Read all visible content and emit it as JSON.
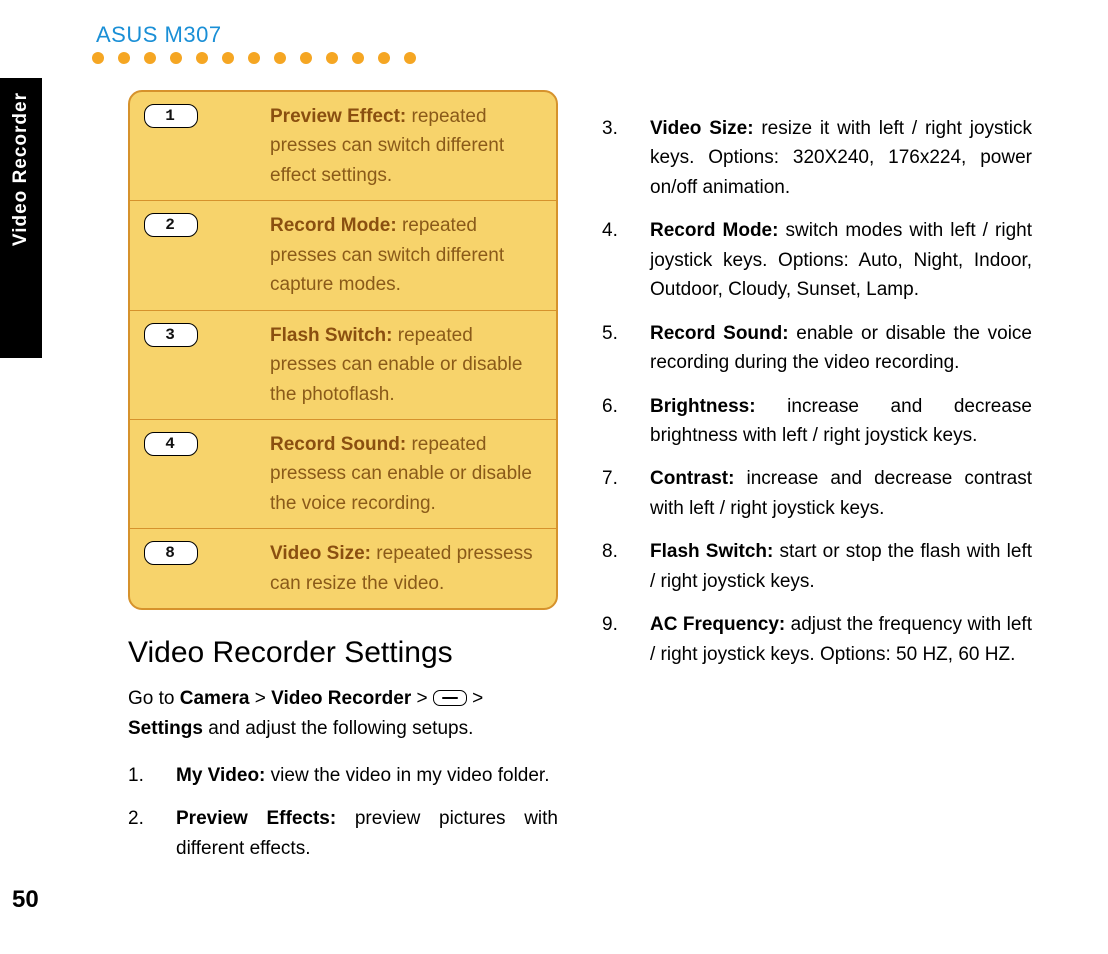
{
  "doc_title": "ASUS M307",
  "side_tab": "Video Recorder",
  "page_number": "50",
  "key_table": [
    {
      "key": "1",
      "lead": "Preview Effect:",
      "desc": " repeated presses can switch different effect settings."
    },
    {
      "key": "2",
      "lead": "Record Mode:",
      "desc": " repeated presses can switch different capture modes."
    },
    {
      "key": "3",
      "lead": "Flash Switch:",
      "desc": " repeated presses can enable or disable the photoflash."
    },
    {
      "key": "4",
      "lead": "Record Sound:",
      "desc": " repeated pressess can enable or disable the voice recording."
    },
    {
      "key": "8",
      "lead": "Video Size:",
      "desc": " repeated pressess can resize the video."
    }
  ],
  "section_heading": "Video Recorder Settings",
  "intro": {
    "pre": "Go to ",
    "b1": "Camera",
    "sep1": " > ",
    "b2": "Video Recorder",
    "sep2": " > ",
    "sep3": " > ",
    "b3": "Settings",
    "post": " and adjust the following setups."
  },
  "settings_left": [
    {
      "lead": "My Video:",
      "desc": " view the video in my video folder."
    },
    {
      "lead": "Preview Effects:",
      "desc": " preview pictures with different effects."
    }
  ],
  "settings_right": [
    {
      "lead": "Video Size:",
      "desc": " resize it with left / right joystick keys. Options: 320X240, 176x224, power on/off animation."
    },
    {
      "lead": "Record Mode:",
      "desc": " switch modes with left / right joystick keys. Options: Auto, Night, Indoor, Outdoor, Cloudy, Sunset, Lamp."
    },
    {
      "lead": "Record Sound:",
      "desc": "  enable or disable the voice recording during the video recording."
    },
    {
      "lead": "Brightness:",
      "desc": " increase and decrease brightness with left / right joystick keys."
    },
    {
      "lead": "Contrast:",
      "desc": " increase and decrease contrast with left / right joystick keys."
    },
    {
      "lead": "Flash Switch:",
      "desc": " start or stop the flash with left / right joystick keys."
    },
    {
      "lead": "AC Frequency:",
      "desc": " adjust the frequency with left / right joystick keys. Options: 50 HZ, 60 HZ."
    }
  ]
}
